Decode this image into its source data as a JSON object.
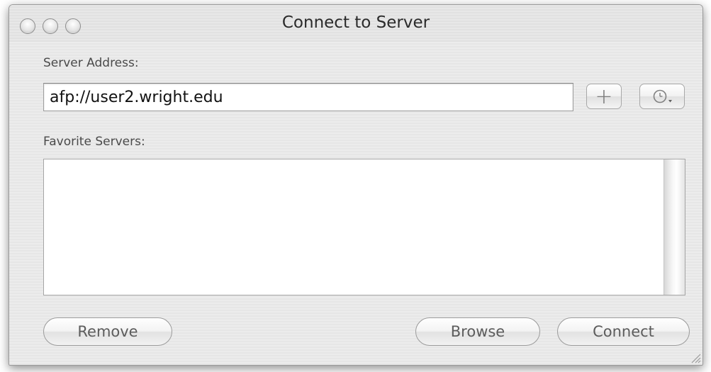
{
  "window": {
    "title": "Connect to Server"
  },
  "server_address": {
    "label": "Server Address:",
    "value": "afp://user2.wright.edu"
  },
  "buttons": {
    "add_favorite": "+",
    "remove": "Remove",
    "browse": "Browse",
    "connect": "Connect"
  },
  "favorites": {
    "label": "Favorite Servers:",
    "items": []
  },
  "icons": {
    "add": "plus-icon",
    "recent": "clock-icon"
  }
}
